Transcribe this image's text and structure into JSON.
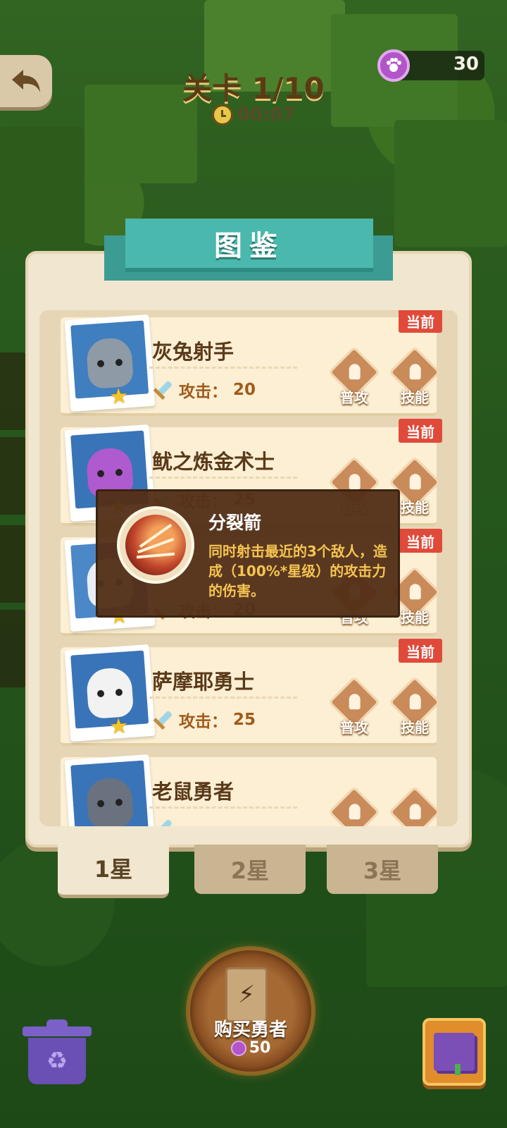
{
  "hud": {
    "level": "关卡 1/10",
    "timer": "00:07",
    "coins": "30"
  },
  "panel": {
    "title": "图鉴"
  },
  "heroes": [
    {
      "name": "灰兔射手",
      "attack_label": "攻击：",
      "attack_value": "20",
      "badge": "当前",
      "normal_label": "普攻",
      "skill_label": "技能"
    },
    {
      "name": "鱿之炼金术士",
      "attack_label": "攻击：",
      "attack_value": "25",
      "badge": "当前",
      "normal_label": "普攻",
      "skill_label": "技能"
    },
    {
      "name": "",
      "attack_label": "攻击：",
      "attack_value": "20",
      "badge": "当前",
      "normal_label": "普攻",
      "skill_label": "技能"
    },
    {
      "name": "萨摩耶勇士",
      "attack_label": "攻击：",
      "attack_value": "25",
      "badge": "当前",
      "normal_label": "普攻",
      "skill_label": "技能"
    },
    {
      "name": "老鼠勇者",
      "attack_label": "",
      "attack_value": "",
      "badge": "",
      "normal_label": "",
      "skill_label": ""
    }
  ],
  "tooltip": {
    "title": "分裂箭",
    "description": "同时射击最近的3个敌人，造成（100%*星级）的攻击力的伤害。"
  },
  "tabs": [
    "1星",
    "2星",
    "3星"
  ],
  "active_tab": 0,
  "buy": {
    "label": "购买勇者",
    "cost": "50"
  },
  "colors": {
    "panel": "#f1e6cf",
    "ribbon": "#4ab8ad",
    "badge": "#e04a3a",
    "tooltip_bg": "#533018",
    "tooltip_text": "#f5c451"
  }
}
